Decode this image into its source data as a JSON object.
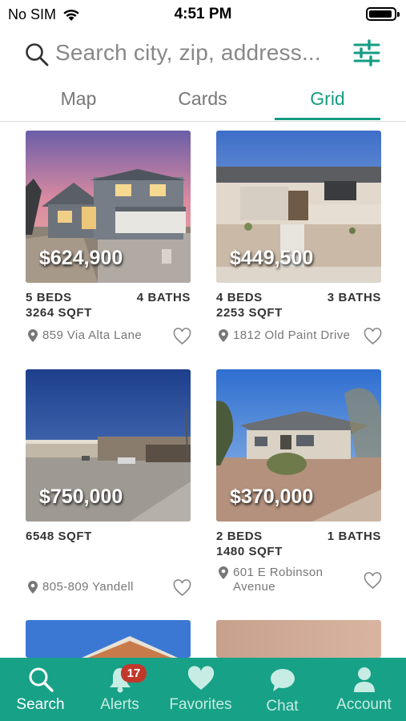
{
  "status": {
    "carrier": "No SIM",
    "time": "4:51 PM"
  },
  "search": {
    "placeholder": "Search city, zip, address..."
  },
  "tabs": [
    {
      "label": "Map"
    },
    {
      "label": "Cards"
    },
    {
      "label": "Grid",
      "active": true
    }
  ],
  "listings": [
    {
      "price": "$624,900",
      "beds": "5 BEDS",
      "baths": "4 BATHS",
      "sqft": "3264 SQFT",
      "address": "859 Via Alta Lane"
    },
    {
      "price": "$449,500",
      "beds": "4 BEDS",
      "baths": "3 BATHS",
      "sqft": "2253 SQFT",
      "address": "1812 Old Paint Drive"
    },
    {
      "price": "$750,000",
      "beds": "",
      "baths": "",
      "sqft": "6548 SQFT",
      "address": "805-809 Yandell"
    },
    {
      "price": "$370,000",
      "beds": "2 BEDS",
      "baths": "1 BATHS",
      "sqft": "1480 SQFT",
      "address": "601 E Robinson Avenue"
    }
  ],
  "tabbar": {
    "items": [
      {
        "label": "Search",
        "icon": "search-icon",
        "active": true
      },
      {
        "label": "Alerts",
        "icon": "bell-icon",
        "badge": "17"
      },
      {
        "label": "Favorites",
        "icon": "heart-icon"
      },
      {
        "label": "Chat",
        "icon": "chat-bubble-icon"
      },
      {
        "label": "Account",
        "icon": "person-icon"
      }
    ]
  },
  "colors": {
    "accent": "#159c82",
    "tabbar_bg": "#17a187",
    "badge": "#c0392b"
  }
}
